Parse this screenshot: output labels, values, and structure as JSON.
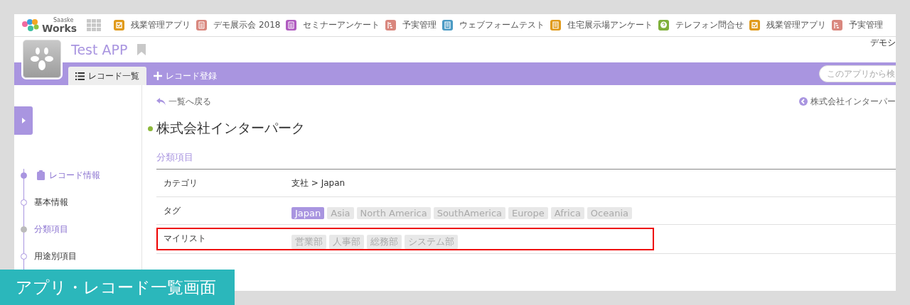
{
  "brand": {
    "small": "Saaske",
    "name": "Works"
  },
  "apps": [
    {
      "name": "残業管理アプリ",
      "kind": "check",
      "color": "#e09a1a"
    },
    {
      "name": "デモ展示会 2018",
      "kind": "doc",
      "color": "#d9877e"
    },
    {
      "name": "セミナーアンケート",
      "kind": "doc",
      "color": "#b05cc0"
    },
    {
      "name": "予実管理",
      "kind": "chart",
      "color": "#d9877e"
    },
    {
      "name": "ウェブフォームテスト",
      "kind": "list",
      "color": "#4a9ac4"
    },
    {
      "name": "住宅展示場アンケート",
      "kind": "list",
      "color": "#e09a1a"
    },
    {
      "name": "テレフォン問合せ",
      "kind": "question",
      "color": "#7fb03a"
    },
    {
      "name": "残業管理アプリ",
      "kind": "check",
      "color": "#e09a1a"
    },
    {
      "name": "予実管理",
      "kind": "chart",
      "color": "#d9877e"
    }
  ],
  "user": "デモシ",
  "app_title": "Test APP",
  "tabs": [
    {
      "label": "レコード一覧",
      "kind": "list",
      "selected": true
    },
    {
      "label": "レコード登録",
      "kind": "add",
      "selected": false
    }
  ],
  "search": {
    "placeholder": "このアプリから検"
  },
  "sidebar": {
    "items": [
      {
        "label": "レコード情報",
        "kind": "section",
        "selected": false
      },
      {
        "label": "基本情報",
        "kind": "item",
        "selected": false
      },
      {
        "label": "分類項目",
        "kind": "item",
        "selected": true
      },
      {
        "label": "用途別項目",
        "kind": "item",
        "selected": false
      }
    ]
  },
  "back_link": "一覧へ戻る",
  "prev_link": "株式会社インターパー",
  "record_title": "株式会社インターパーク",
  "section_title": "分類項目",
  "fields": [
    {
      "label": "カテゴリ",
      "kind": "text",
      "value": "支社 > Japan",
      "highlighted": false
    },
    {
      "label": "タグ",
      "kind": "tags",
      "highlighted": false,
      "tags": [
        {
          "label": "Japan",
          "selected": true
        },
        {
          "label": "Asia",
          "selected": false
        },
        {
          "label": "North America",
          "selected": false
        },
        {
          "label": "SouthAmerica",
          "selected": false
        },
        {
          "label": "Europe",
          "selected": false
        },
        {
          "label": "Africa",
          "selected": false
        },
        {
          "label": "Oceania",
          "selected": false
        }
      ]
    },
    {
      "label": "マイリスト",
      "kind": "tags",
      "highlighted": true,
      "tags": [
        {
          "label": "営業部",
          "selected": false
        },
        {
          "label": "人事部",
          "selected": false
        },
        {
          "label": "総務部",
          "selected": false
        },
        {
          "label": "システム部",
          "selected": false
        }
      ]
    }
  ],
  "caption": "アプリ・レコード一覧画面"
}
